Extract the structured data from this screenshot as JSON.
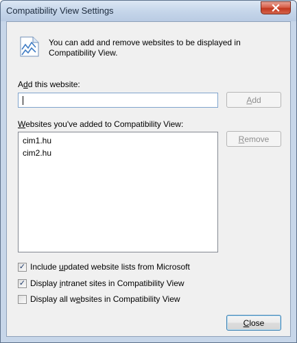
{
  "window": {
    "title": "Compatibility View Settings"
  },
  "info": {
    "icon": "compatibility-view-icon",
    "text": "You can add and remove websites to be displayed in Compatibility View."
  },
  "add_section": {
    "label_accesskey": "d",
    "label_before": "A",
    "label_after": "d this website:",
    "input_value": "",
    "add_button_prefix": "",
    "add_button_accesskey": "A",
    "add_button_suffix": "dd"
  },
  "list_section": {
    "label_accesskey": "W",
    "label_rest": "ebsites you've added to Compatibility View:",
    "items": [
      "cim1.hu",
      "cim2.hu"
    ],
    "remove_button_accesskey": "R",
    "remove_button_suffix": "emove"
  },
  "options": [
    {
      "before": "Include ",
      "accesskey": "u",
      "after": "pdated website lists from Microsoft",
      "checked": true
    },
    {
      "before": "Display ",
      "accesskey": "i",
      "after": "ntranet sites in Compatibility View",
      "checked": true
    },
    {
      "before": "Display all w",
      "accesskey": "e",
      "after": "bsites in Compatibility View",
      "checked": false
    }
  ],
  "footer": {
    "close_accesskey": "C",
    "close_suffix": "lose"
  },
  "colors": {
    "titlebar": "#c6d6ea",
    "content_bg": "#f0f0f0",
    "close_button": "#d7604a"
  }
}
